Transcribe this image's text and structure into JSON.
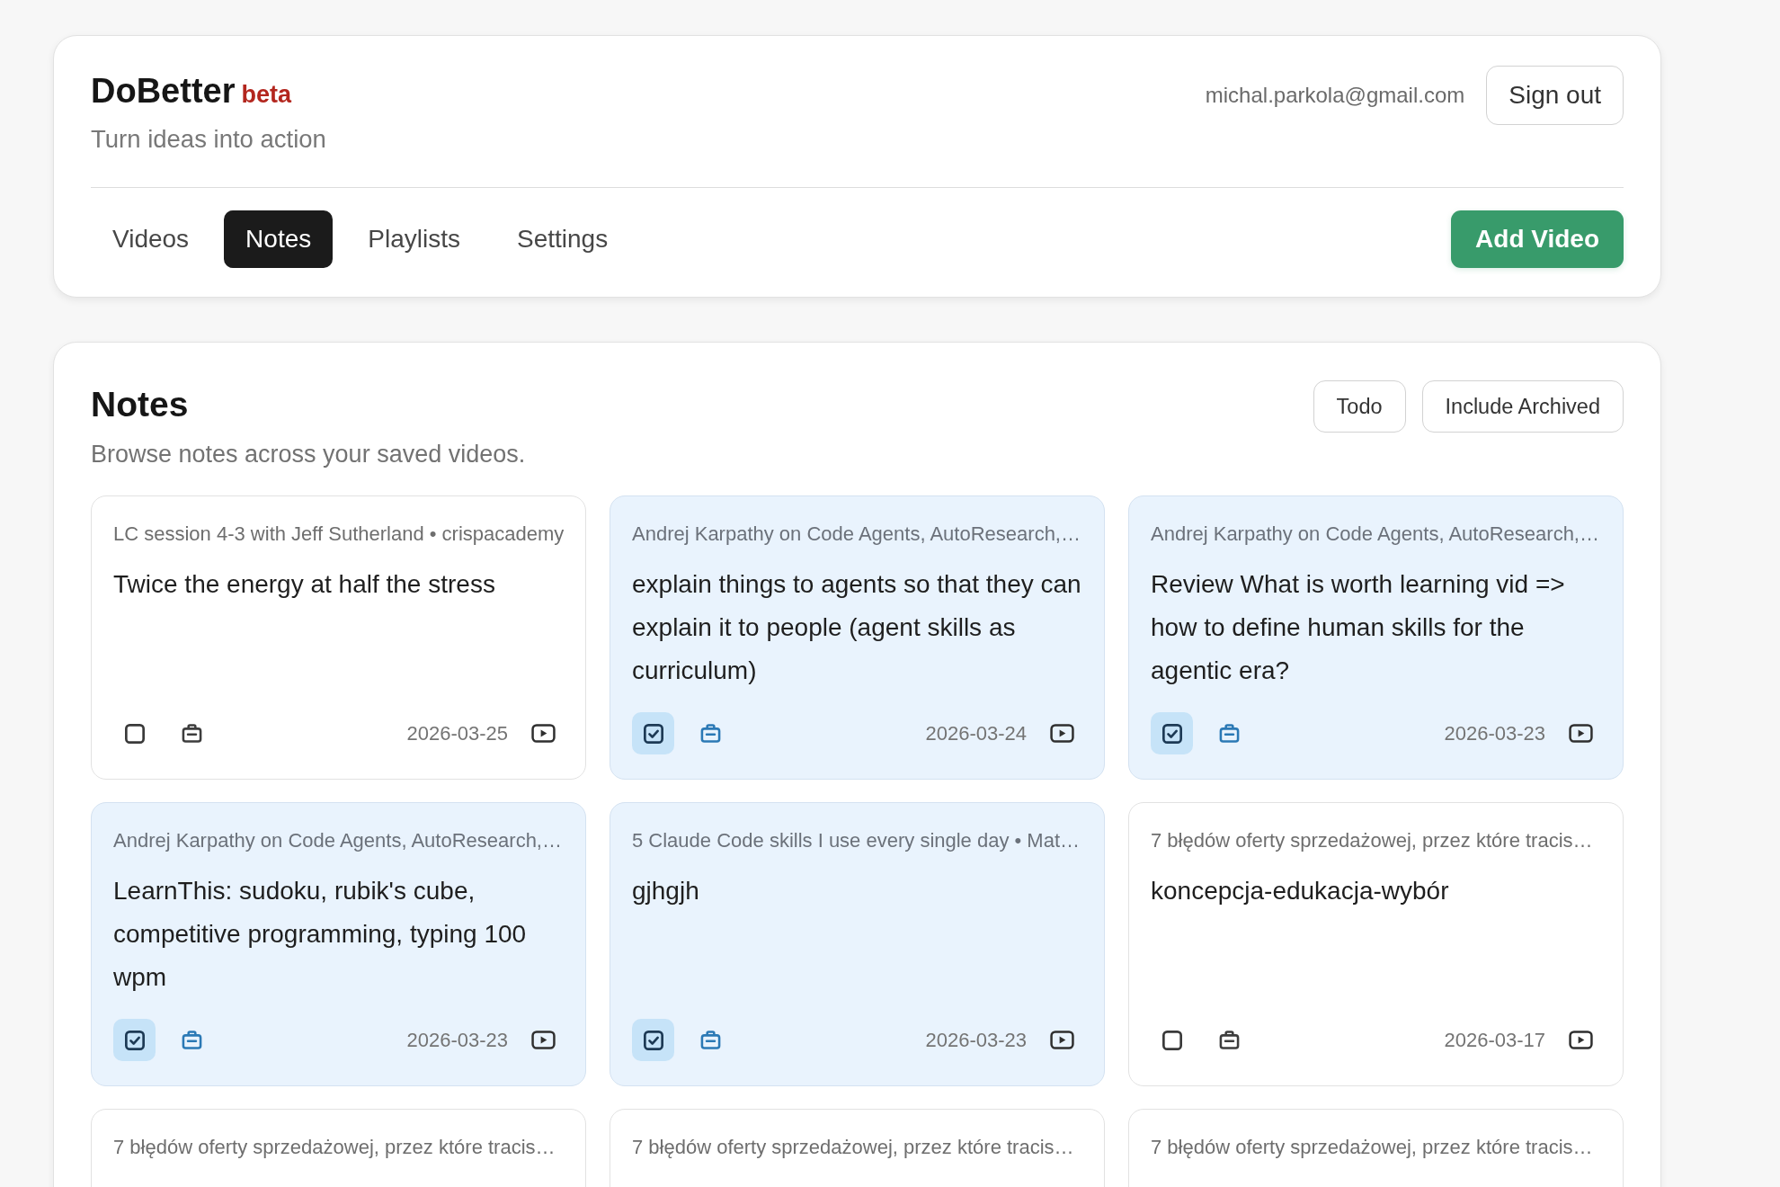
{
  "app": {
    "name": "DoBetter",
    "badge": "beta",
    "tagline": "Turn ideas into action",
    "user_email": "michal.parkola@gmail.com",
    "sign_out_button": "Sign out"
  },
  "nav": {
    "tabs": [
      {
        "label": "Videos",
        "selected": false
      },
      {
        "label": "Notes",
        "selected": true
      },
      {
        "label": "Playlists",
        "selected": false
      },
      {
        "label": "Settings",
        "selected": false
      }
    ],
    "add_button": "Add Video"
  },
  "notes_panel": {
    "title": "Notes",
    "subtitle": "Browse notes across your saved videos.",
    "filters": [
      "Todo",
      "Include Archived"
    ],
    "notes": [
      {
        "source": "LC session 4-3 with Jeff Sutherland • crispacademy",
        "text": "Twice the energy at half the stress",
        "done": false,
        "date": "2026-03-25"
      },
      {
        "source": "Andrej Karpathy on Code Agents, AutoResearch,…",
        "text": "explain things to agents so that they can explain it to people (agent skills as curriculum)",
        "done": true,
        "date": "2026-03-24"
      },
      {
        "source": "Andrej Karpathy on Code Agents, AutoResearch,…",
        "text": "Review What is worth learning vid => how to define human skills for the agentic era?",
        "done": true,
        "date": "2026-03-23"
      },
      {
        "source": "Andrej Karpathy on Code Agents, AutoResearch,…",
        "text": "LearnThis: sudoku, rubik's cube, competitive programming, typing 100 wpm",
        "done": true,
        "date": "2026-03-23"
      },
      {
        "source": "5 Claude Code skills I use every single day • Mat…",
        "text": "gjhgjh",
        "done": true,
        "date": "2026-03-23"
      },
      {
        "source": "7 błędów oferty sprzedażowej, przez które tracis…",
        "text": "koncepcja-edukacja-wybór",
        "done": false,
        "date": "2026-03-17"
      },
      {
        "source": "7 błędów oferty sprzedażowej, przez które tracis…",
        "done": false
      },
      {
        "source": "7 błędów oferty sprzedażowej, przez które tracis…",
        "done": false
      },
      {
        "source": "7 błędów oferty sprzedażowej, przez które tracis…",
        "done": false
      }
    ]
  }
}
